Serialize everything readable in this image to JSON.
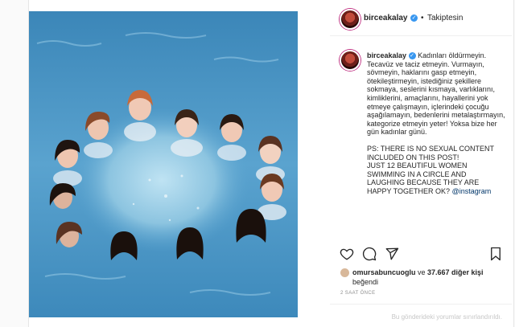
{
  "post": {
    "username": "birceakalay",
    "follow_status": "Takiptesin",
    "separator": "•",
    "caption_username": "birceakalay",
    "caption_text": "Kadınları öldürmeyin. Tecavüz ve taciz etmeyin. Vurmayın, sövmeyin, haklarını gasp etmeyin, ötekileştirmeyin, istediğiniz şekillere sokmaya, seslerini kısmaya, varlıklarını, kimliklerini, amaçlarını, hayallerini yok etmeye çalışmayın, içlerindeki çocuğu aşağılamayın, bedenlerini metalaştırmayın, kategorize etmeyin yeter! Yoksa bize her gün kadınlar günü.",
    "caption_ps": "PS: THERE IS NO SEXUAL CONTENT INCLUDED ON THIS POST!\nJUST 12 BEAUTIFUL WOMEN SWIMMING IN A CIRCLE AND LAUGHING BECAUSE THEY ARE HAPPY TOGETHER OK?",
    "caption_mention": "@instagram",
    "liked_by_user": "omursabuncuoglu",
    "liked_by_middle": " ve ",
    "liked_count": "37.667 diğer kişi",
    "liked_suffix": "beğendi",
    "timestamp": "2 SAAT ÖNCE",
    "comments_disabled": "Bu gönderideki yorumlar sınırlandırıldı."
  },
  "icons": {
    "like": "heart-icon",
    "comment": "comment-icon",
    "share": "share-icon",
    "save": "bookmark-icon",
    "verified": "verified-badge-icon"
  },
  "colors": {
    "water": "#4f95c2",
    "verified": "#3897f0",
    "text": "#262626",
    "muted": "#8e8e8e"
  }
}
